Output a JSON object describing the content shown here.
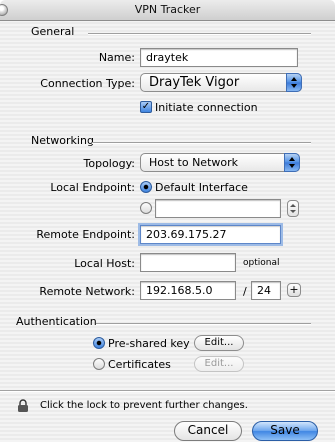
{
  "window": {
    "title": "VPN Tracker"
  },
  "general": {
    "section_title": "General",
    "name_label": "Name:",
    "name_value": "draytek",
    "connection_type_label": "Connection Type:",
    "connection_type_value": "DrayTek Vigor",
    "initiate_label": "Initiate connection",
    "initiate_checked": true
  },
  "networking": {
    "section_title": "Networking",
    "topology_label": "Topology:",
    "topology_value": "Host to Network",
    "local_endpoint_label": "Local Endpoint:",
    "default_interface_label": "Default Interface",
    "local_endpoint_selected": "Default Interface",
    "custom_endpoint_value": "",
    "remote_endpoint_label": "Remote Endpoint:",
    "remote_endpoint_value": "203.69.175.27",
    "local_host_label": "Local Host:",
    "local_host_value": "",
    "optional_label": "optional",
    "remote_network_label": "Remote Network:",
    "remote_network_value": "192.168.5.0",
    "slash": "/",
    "prefix_value": "24",
    "add_label": "+"
  },
  "authentication": {
    "section_title": "Authentication",
    "preshared_label": "Pre-shared key",
    "certificates_label": "Certificates",
    "selected": "Pre-shared key",
    "edit_label": "Edit...",
    "edit_cert_label": "Edit..."
  },
  "footer": {
    "lock_text": "Click the lock to prevent further changes.",
    "cancel_label": "Cancel",
    "save_label": "Save"
  },
  "colors": {
    "accent": "#3f86e3",
    "focus_ring": "#9dbbe6"
  }
}
